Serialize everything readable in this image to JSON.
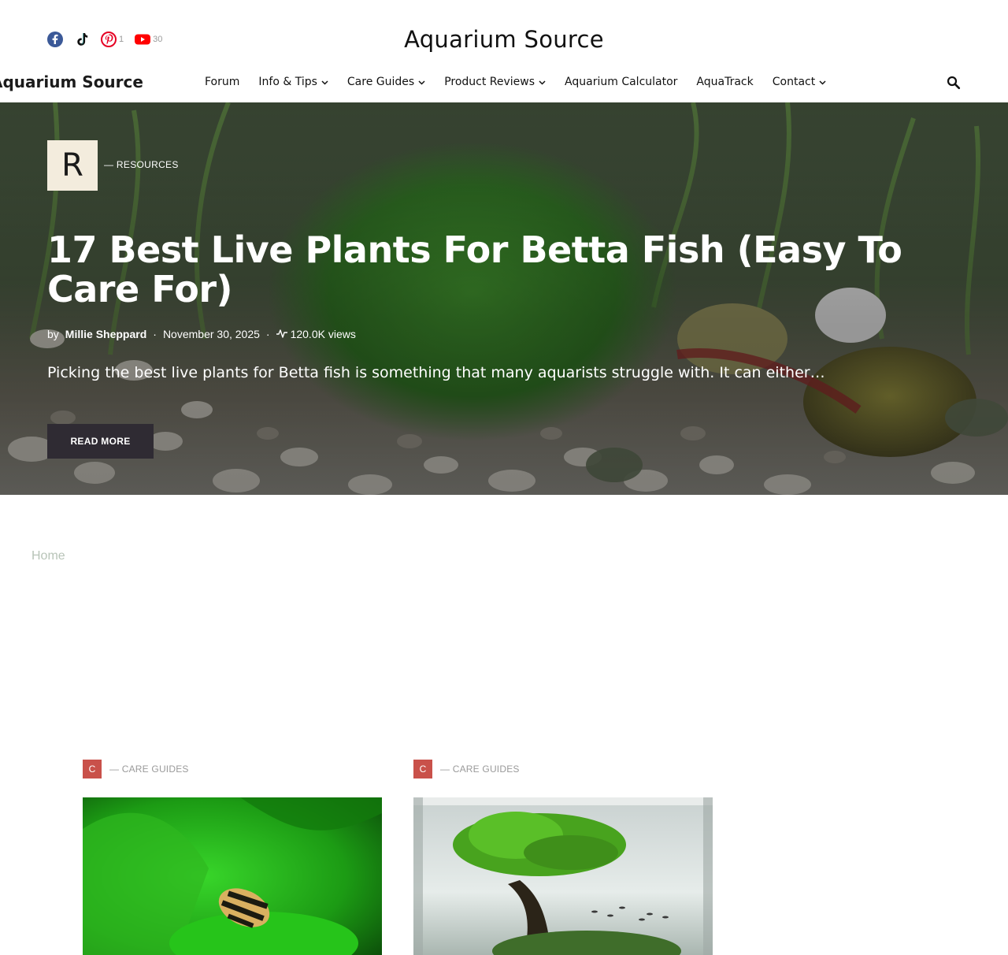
{
  "header": {
    "site_title": "Aquarium Source",
    "social": [
      {
        "icon": "facebook-icon",
        "count": "",
        "color": "#3b5998"
      },
      {
        "icon": "tiktok-icon",
        "count": "",
        "color": "#000000"
      },
      {
        "icon": "pinterest-icon",
        "count": "1",
        "color": "#e60023"
      },
      {
        "icon": "youtube-icon",
        "count": "30",
        "color": "#ff0000"
      }
    ]
  },
  "nav": {
    "logo_text": "Aquarium Source",
    "items": [
      {
        "label": "Forum",
        "dropdown": false
      },
      {
        "label": "Info & Tips",
        "dropdown": true
      },
      {
        "label": "Care Guides",
        "dropdown": true
      },
      {
        "label": "Product Reviews",
        "dropdown": true
      },
      {
        "label": "Aquarium Calculator",
        "dropdown": false
      },
      {
        "label": "AquaTrack",
        "dropdown": false
      },
      {
        "label": "Contact",
        "dropdown": true
      }
    ],
    "search_icon": "search-icon"
  },
  "hero": {
    "category_initial": "R",
    "category_label": "— RESOURCES",
    "title": "17 Best Live Plants For Betta Fish (Easy To Care For)",
    "meta": {
      "by": "by",
      "author": "Millie Sheppard",
      "sep": "·",
      "date": "November 30, 2025",
      "views": "120.0K views"
    },
    "excerpt": "Picking the best live plants for Betta fish is something that many aquarists struggle with. It can either…",
    "read_more": "READ MORE"
  },
  "breadcrumb": {
    "home": "Home"
  },
  "cards": [
    {
      "category_initial": "C",
      "category_label": "— CARE GUIDES",
      "accent": "#c9514a"
    },
    {
      "category_initial": "C",
      "category_label": "— CARE GUIDES",
      "accent": "#c9514a"
    }
  ]
}
